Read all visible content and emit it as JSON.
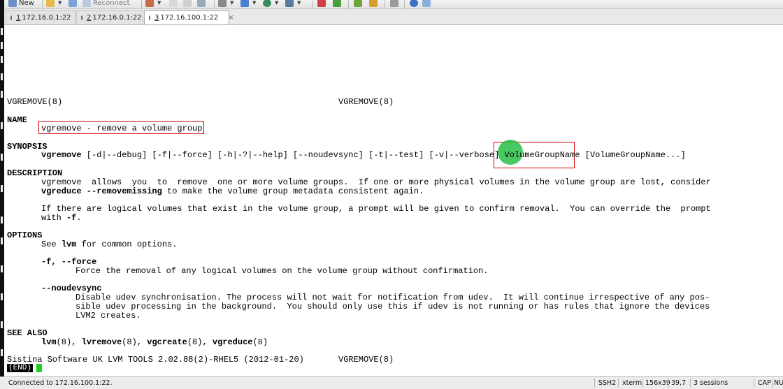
{
  "toolbar": {
    "new_label": "New",
    "reconnect_label": "Reconnect"
  },
  "tabs": [
    {
      "number": "1",
      "title": "172.16.0.1:22",
      "active": false
    },
    {
      "number": "2",
      "title": "172.16.0.1:22",
      "active": false
    },
    {
      "number": "3",
      "title": "172.16.100.1:22",
      "active": true
    }
  ],
  "tab_close_glyph": "×",
  "terminal": {
    "header_left": "VGREMOVE(8)",
    "header_right": "VGREMOVE(8)",
    "name_heading": "NAME",
    "name_text": "vgremove - remove a volume group",
    "synopsis_heading": "SYNOPSIS",
    "synopsis_cmd": "vgremove",
    "synopsis_opts": " [-d|--debug] [-f|--force] [-h|-?|--help] [--noudevsync] [-t|--test] [-v|--verbose] ",
    "synopsis_vgname_part1": "Vol",
    "synopsis_vgname_part2": "umeGroupName",
    "synopsis_tail": " [VolumeGroupName...]",
    "description_heading": "DESCRIPTION",
    "desc_line1": "vgremove  allows  you  to  remove  one or more volume groups.  If one or more physical volumes in the volume group are lost, consider",
    "desc_line2_bold": "vgreduce --removemissing",
    "desc_line2_rest": " to make the volume group metadata consistent again.",
    "desc_line3": "If there are logical volumes that exist in the volume group, a prompt will be given to confirm removal.  You can override the  prompt",
    "desc_line4_pre": "with ",
    "desc_line4_bold": "-f",
    "desc_line4_post": ".",
    "options_heading": "OPTIONS",
    "opt_see_pre": "See ",
    "opt_see_bold": "lvm",
    "opt_see_post": " for common options.",
    "opt_force_flags": "-f, --force",
    "opt_force_desc": "Force the removal of any logical volumes on the volume group without confirmation.",
    "opt_noudev_flag": "--noudevsync",
    "opt_noudev_desc1": "Disable udev synchronisation. The process will not wait for notification from udev.  It will continue irrespective of any pos-",
    "opt_noudev_desc2": "sible udev processing in the background.  You should only use this if udev is not running or has rules that ignore the devices",
    "opt_noudev_desc3": "LVM2 creates.",
    "seealso_heading": "SEE ALSO",
    "seealso_1": "lvm",
    "seealso_1s": "(8), ",
    "seealso_2": "lvremove",
    "seealso_2s": "(8), ",
    "seealso_3": "vgcreate",
    "seealso_3s": "(8), ",
    "seealso_4": "vgreduce",
    "seealso_4s": "(8)",
    "footer_left": "Sistina Software UK LVM TOOLS 2.02.88(2)-RHEL5 (2012-01-20)",
    "footer_right": "VGREMOVE(8)",
    "pager_end": "(END)"
  },
  "statusbar": {
    "connection": "Connected to 172.16.100.1:22.",
    "protocol": "SSH2",
    "terminal_type": "xterm",
    "size": "156x39",
    "cursor_pos": "39,7",
    "sessions": "3 sessions",
    "caps": "CAP",
    "num": "NU"
  },
  "colors": {
    "highlight_box": "#d00000",
    "cursor_marker": "#28be46",
    "end_cursor": "#1fd11f"
  }
}
